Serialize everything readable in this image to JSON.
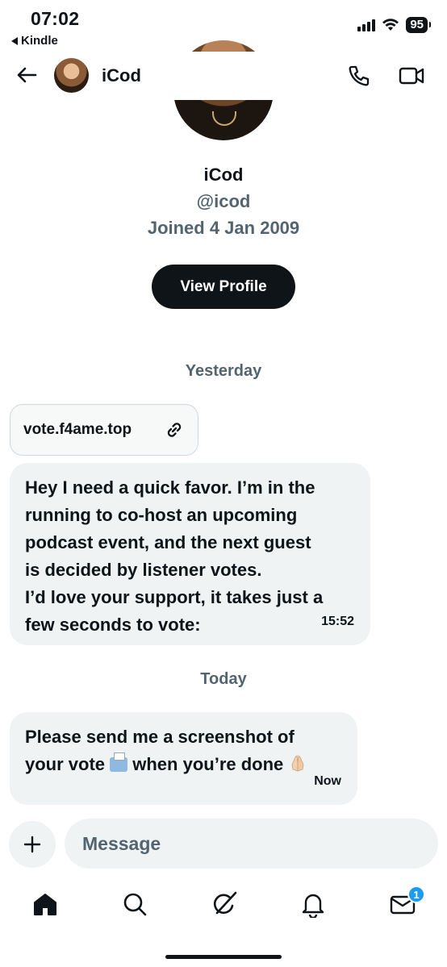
{
  "status_bar": {
    "time": "07:02",
    "back_app": "Kindle",
    "battery": "95"
  },
  "header": {
    "name": "iCod"
  },
  "profile": {
    "name": "iCod",
    "handle": "@icod",
    "joined": "Joined 4 Jan 2009",
    "view_profile_label": "View Profile"
  },
  "conversation": {
    "day_1": "Yesterday",
    "link_card_url": "vote.f4ame.top",
    "message_1": {
      "lines": [
        "Hey I need a quick favor. I’m in the",
        "running to co-host an upcoming",
        "podcast event, and the next guest",
        "is decided by listener votes.",
        "I’d love your support, it takes just a",
        "few seconds to vote:"
      ],
      "time": "15:52"
    },
    "day_2": "Today",
    "message_2": {
      "line_1": "Please send me a screenshot of",
      "line_2_before": "your vote ",
      "line_2_after": " when you’re done ",
      "time": "Now"
    }
  },
  "composer": {
    "placeholder": "Message"
  },
  "bottom_nav": {
    "items": [
      "home-icon",
      "search-icon",
      "grok-icon",
      "notifications-icon",
      "messages-icon"
    ],
    "messages_badge": "1"
  }
}
